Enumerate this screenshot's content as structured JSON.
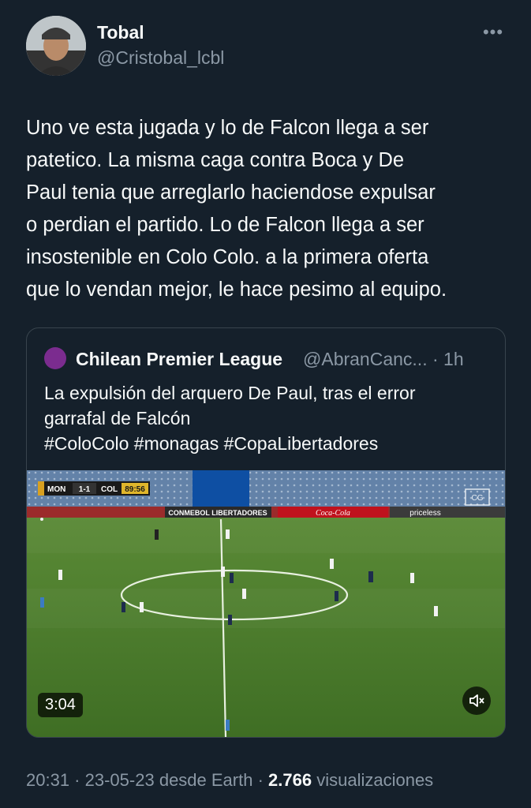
{
  "author": {
    "name": "Tobal",
    "handle": "@Cristobal_lcbl",
    "more_icon": "more-horizontal-icon"
  },
  "tweet": {
    "lines": [
      "Uno ve esta jugada y lo de Falcon llega a ser",
      "patetico. La misma caga contra Boca y De",
      "Paul tenia que arreglarlo haciendose expulsar",
      "o perdian el partido. Lo de Falcon llega a ser",
      "insostenible en Colo Colo. a la primera oferta",
      "que lo vendan mejor, le hace pesimo al equipo."
    ]
  },
  "quote": {
    "name": "Chilean Premier League",
    "meta": "@AbranCanc... · 1h",
    "lines": [
      "La expulsión del arquero De Paul, tras el error",
      "garrafal de Falcón",
      "#ColoColo #monagas #CopaLibertadores"
    ],
    "video": {
      "duration": "3:04",
      "scoreboard": {
        "home": "MON",
        "score": "1-1",
        "away": "COL",
        "clock": "89:56"
      },
      "boards": [
        "CONMEBOL LIBERTADORES",
        "Coca-Cola",
        "priceless"
      ],
      "colors": {
        "pitch": "#4c7b2f",
        "stands": "#6b86a8"
      }
    }
  },
  "footer": {
    "time": "20:31",
    "date": "23-05-23",
    "source": "desde Earth",
    "views": "2.766",
    "views_label": "visualizaciones"
  }
}
